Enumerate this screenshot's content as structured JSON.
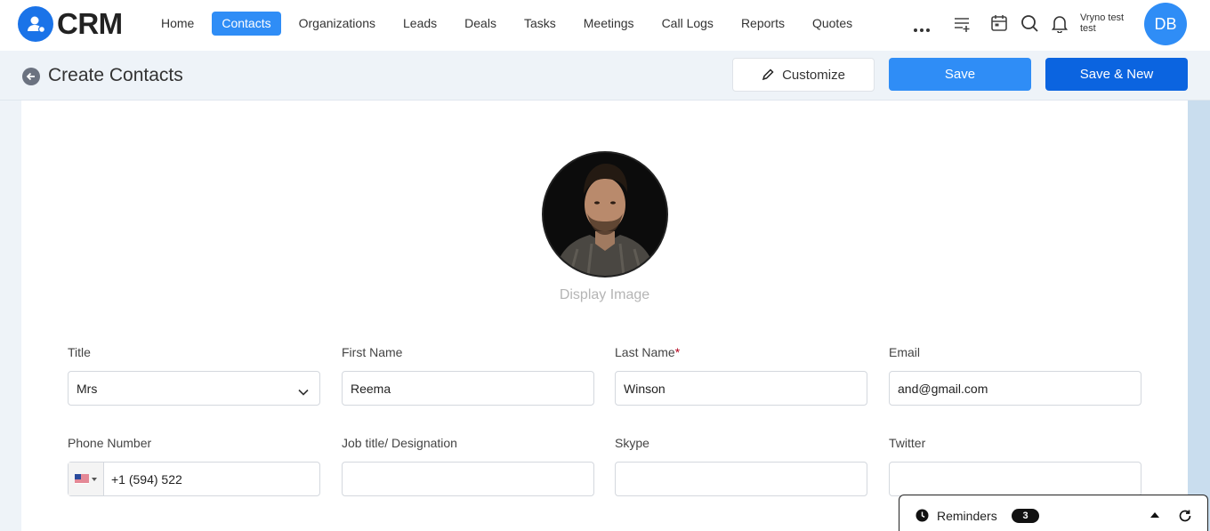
{
  "app": {
    "logo_text": "CRM"
  },
  "nav": {
    "items": [
      "Home",
      "Contacts",
      "Organizations",
      "Leads",
      "Deals",
      "Tasks",
      "Meetings",
      "Call Logs",
      "Reports",
      "Quotes"
    ],
    "active": "Contacts"
  },
  "user": {
    "name_line1": "Vryno test",
    "name_line2": "test",
    "initials": "DB"
  },
  "header": {
    "title": "Create Contacts",
    "customize_label": "Customize",
    "save_label": "Save",
    "save_new_label": "Save & New"
  },
  "photo": {
    "caption": "Display Image"
  },
  "form": {
    "title": {
      "label": "Title",
      "value": "Mrs"
    },
    "first_name": {
      "label": "First Name",
      "value": "Reema"
    },
    "last_name": {
      "label": "Last Name",
      "required_mark": "*",
      "value": "Winson"
    },
    "email": {
      "label": "Email",
      "value": "and@gmail.com"
    },
    "phone": {
      "label": "Phone Number",
      "value": "+1 (594) 522",
      "country": "US"
    },
    "job_title": {
      "label": "Job title/ Designation",
      "value": ""
    },
    "skype": {
      "label": "Skype",
      "value": ""
    },
    "twitter": {
      "label": "Twitter",
      "value": ""
    }
  },
  "reminders": {
    "label": "Reminders",
    "count": "3"
  },
  "colors": {
    "accent": "#2f8df6",
    "accent_dark": "#0b64e0",
    "required": "#b3001b"
  }
}
